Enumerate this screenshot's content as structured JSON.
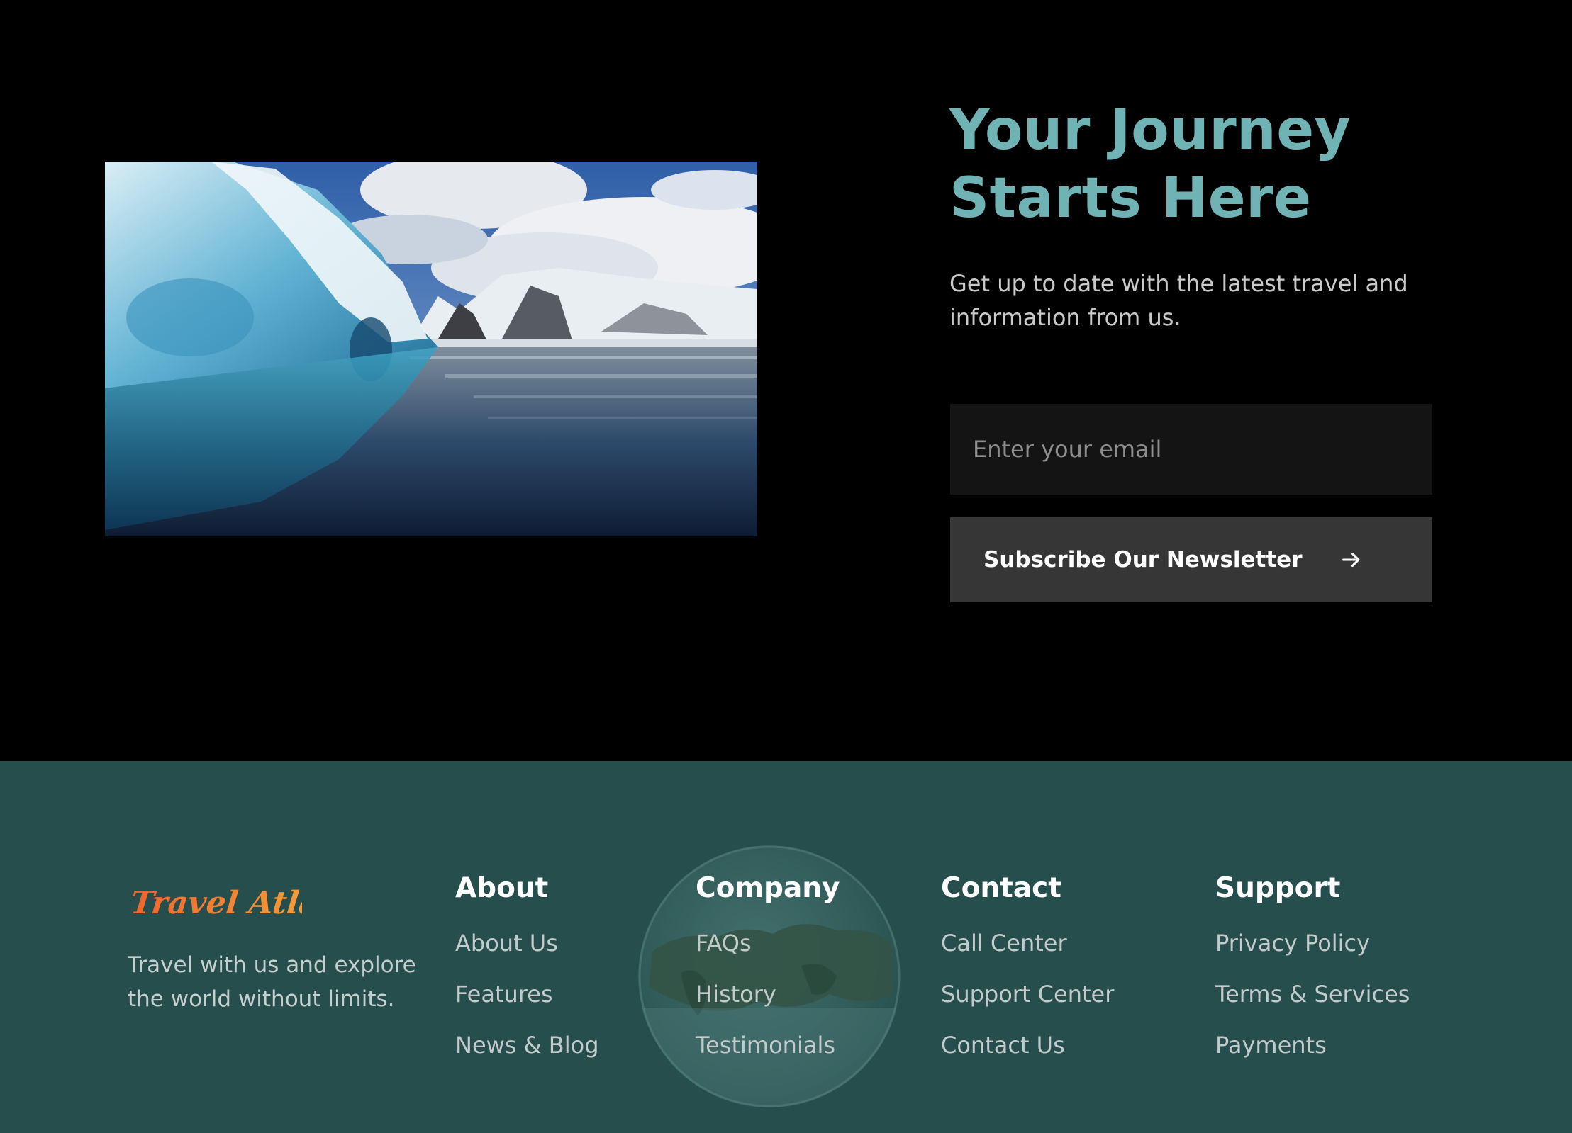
{
  "newsletter": {
    "headline_line1": "Your Journey",
    "headline_line2": "Starts Here",
    "subtext": "Get up to date with the latest travel and information from us.",
    "email_placeholder": "Enter your email",
    "subscribe_label": "Subscribe Our Newsletter",
    "subscribe_icon": "arrow-right-icon",
    "image_subject": "iceberg",
    "headline_color": "#6fb3b4"
  },
  "footer": {
    "background_color": "#254e4c",
    "brand": {
      "logo_text": "Travel Atlas",
      "description": "Travel with us and explore the world without limits.",
      "logo_color": "#f07a2c"
    },
    "columns": [
      {
        "title": "About",
        "links": [
          "About Us",
          "Features",
          "News & Blog"
        ]
      },
      {
        "title": "Company",
        "links": [
          "FAQs",
          "History",
          "Testimonials"
        ]
      },
      {
        "title": "Contact",
        "links": [
          "Call Center",
          "Support Center",
          "Contact Us"
        ]
      },
      {
        "title": "Support",
        "links": [
          "Privacy Policy",
          "Terms & Services",
          "Payments"
        ]
      }
    ]
  }
}
